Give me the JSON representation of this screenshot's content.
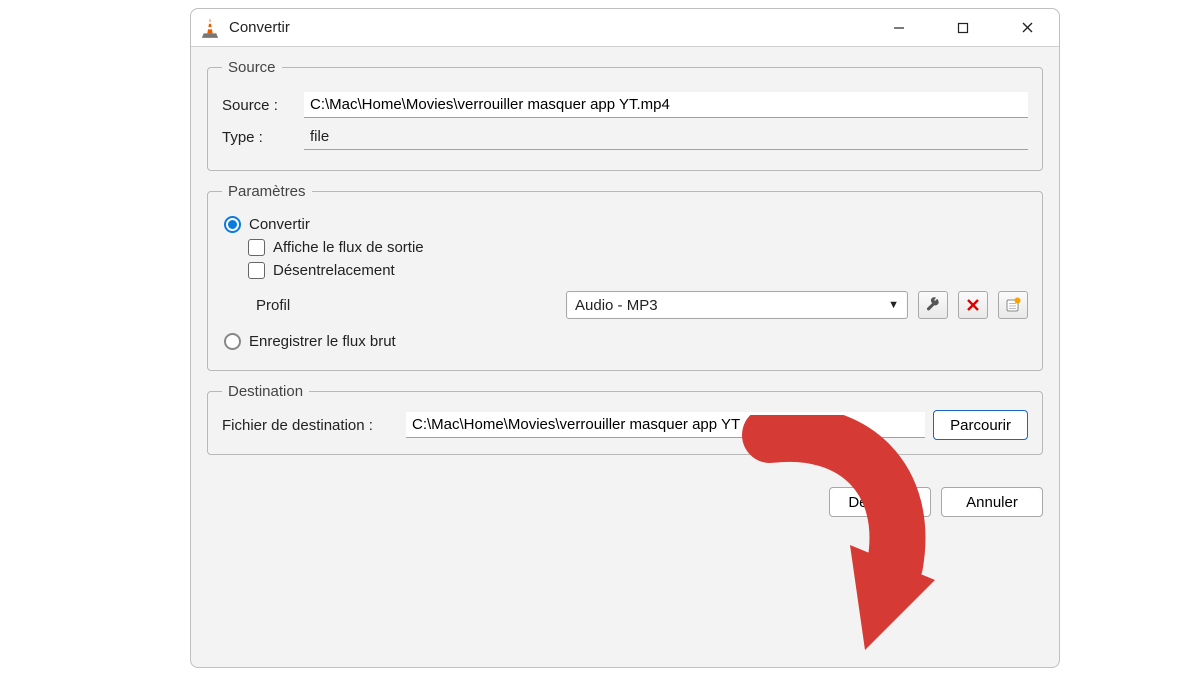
{
  "window": {
    "title": "Convertir"
  },
  "source_group": {
    "legend": "Source",
    "source_label": "Source :",
    "source_value": "C:\\Mac\\Home\\Movies\\verrouiller masquer app YT.mp4",
    "type_label": "Type :",
    "type_value": "file"
  },
  "params_group": {
    "legend": "Paramètres",
    "radio_convert": "Convertir",
    "check_display": "Affiche le flux de sortie",
    "check_deinterlace": "Désentrelacement",
    "profile_label": "Profil",
    "profile_value": "Audio - MP3",
    "radio_raw": "Enregistrer le flux brut"
  },
  "dest_group": {
    "legend": "Destination",
    "file_label": "Fichier de destination :",
    "file_value": "C:\\Mac\\Home\\Movies\\verrouiller masquer app YT audio.mp3",
    "browse": "Parcourir"
  },
  "footer": {
    "start": "Démarrer",
    "cancel": "Annuler"
  },
  "icons": {
    "wrench": "wrench-icon",
    "delete": "delete-icon",
    "new_profile": "new-profile-icon"
  }
}
